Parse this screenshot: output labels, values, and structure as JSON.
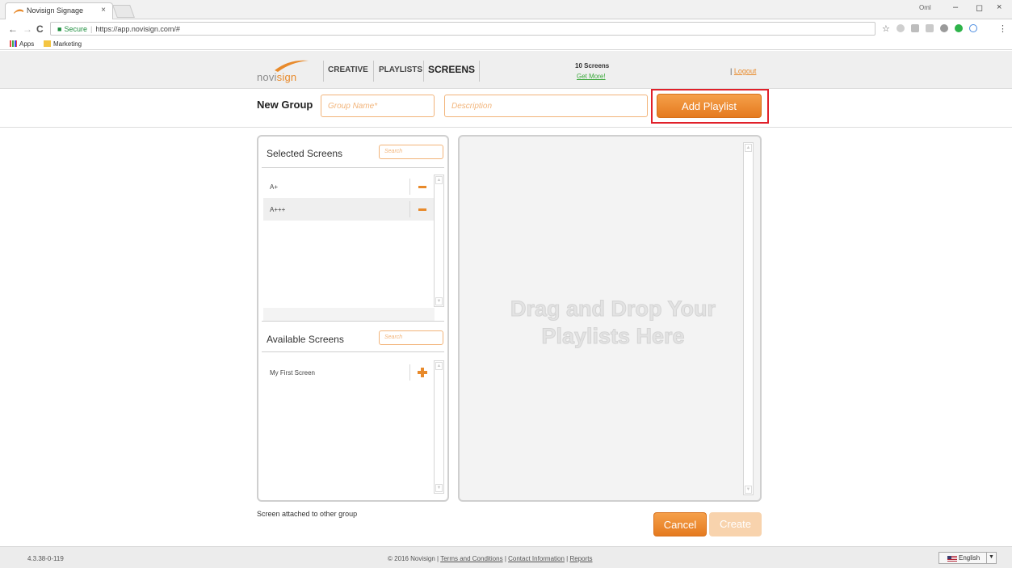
{
  "browser": {
    "tab_title": "Novisign Signage",
    "tab_close": "×",
    "user_badge": "Oml",
    "window_controls": {
      "minimize": "–",
      "restore": "◻",
      "close": "×"
    },
    "nav": {
      "back": "←",
      "forward": "→",
      "reload": "C"
    },
    "address": {
      "secure_label": "Secure",
      "url": "https://app.novisign.com/#"
    },
    "bookmarks": [
      {
        "label": "Apps",
        "icon": "apps-grid-icon"
      },
      {
        "label": "Marketing",
        "icon": "folder-icon"
      }
    ]
  },
  "header": {
    "logo_text_a": "novi",
    "logo_text_b": "sign",
    "nav": [
      {
        "label": "CREATIVE",
        "active": false
      },
      {
        "label": "PLAYLISTS",
        "active": false
      },
      {
        "label": "SCREENS",
        "active": true
      }
    ],
    "screens_count": "10 Screens",
    "get_more": "Get More!",
    "logout_prefix": "|",
    "logout": "Logout"
  },
  "group_form": {
    "title": "New Group",
    "name_placeholder": "Group Name*",
    "description_placeholder": "Description",
    "add_playlist": "Add Playlist"
  },
  "selected_screens": {
    "title": "Selected Screens",
    "search_placeholder": "Search",
    "items": [
      {
        "label": "A+"
      },
      {
        "label": "A+++"
      }
    ]
  },
  "available_screens": {
    "title": "Available Screens",
    "search_placeholder": "Search",
    "items": [
      {
        "label": "My First Screen"
      }
    ]
  },
  "dropzone": {
    "line1": "Drag and Drop Your",
    "line2": "Playlists Here"
  },
  "note": "Screen attached to other group",
  "actions": {
    "cancel": "Cancel",
    "create": "Create"
  },
  "footer": {
    "version": "4.3.38-0-119",
    "copyright": "© 2016 Novisign |",
    "links": [
      "Terms and Conditions",
      "Contact Information",
      "Reports"
    ],
    "separator": "|",
    "language": "English"
  },
  "colors": {
    "accent": "#e88a2b",
    "highlight": "#e0202a",
    "link_green": "#3aa83a"
  }
}
